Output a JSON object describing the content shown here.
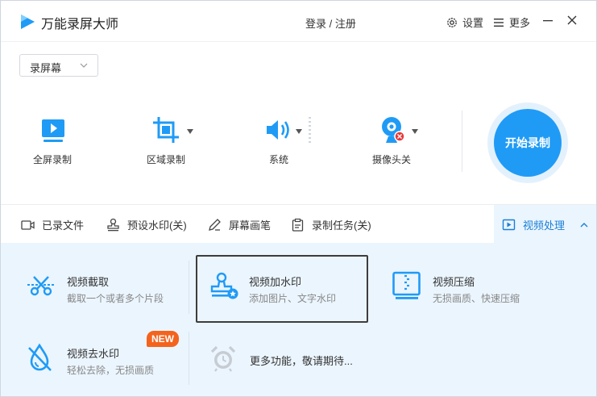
{
  "app": {
    "title": "万能录屏大师"
  },
  "header": {
    "login_label": "登录 / 注册",
    "settings_label": "设置",
    "more_label": "更多"
  },
  "mode_select": {
    "value": "录屏幕"
  },
  "capture_options": [
    {
      "label": "全屏录制",
      "icon": "monitor-play-icon"
    },
    {
      "label": "区域录制",
      "icon": "crop-icon"
    },
    {
      "label": "系统",
      "icon": "speaker-icon"
    },
    {
      "label": "摄像头关",
      "icon": "webcam-off-icon"
    }
  ],
  "record_button": {
    "label": "开始录制"
  },
  "toolbar": [
    {
      "label": "已录文件",
      "icon": "video-file-icon"
    },
    {
      "label": "预设水印(关)",
      "icon": "stamp-icon"
    },
    {
      "label": "屏幕画笔",
      "icon": "pen-icon"
    },
    {
      "label": "录制任务(关)",
      "icon": "clipboard-icon"
    },
    {
      "label": "视频处理",
      "icon": "video-process-icon",
      "active": true
    }
  ],
  "panel": {
    "items": [
      {
        "title": "视频截取",
        "desc": "截取一个或者多个片段",
        "icon": "scissors-icon"
      },
      {
        "title": "视频加水印",
        "desc": "添加图片、文字水印",
        "icon": "watermark-stamp-icon"
      },
      {
        "title": "视频压缩",
        "desc": "无损画质、快速压缩",
        "icon": "compress-icon"
      },
      {
        "title": "视频去水印",
        "desc": "轻松去除，无损画质",
        "icon": "water-drop-off-icon",
        "badge": "NEW"
      },
      {
        "title": "更多功能，敬请期待...",
        "icon": "alarm-clock-icon"
      }
    ]
  },
  "colors": {
    "accent": "#1f9bf6",
    "panel_bg": "#ebf5fe",
    "badge": "#f4631d"
  }
}
